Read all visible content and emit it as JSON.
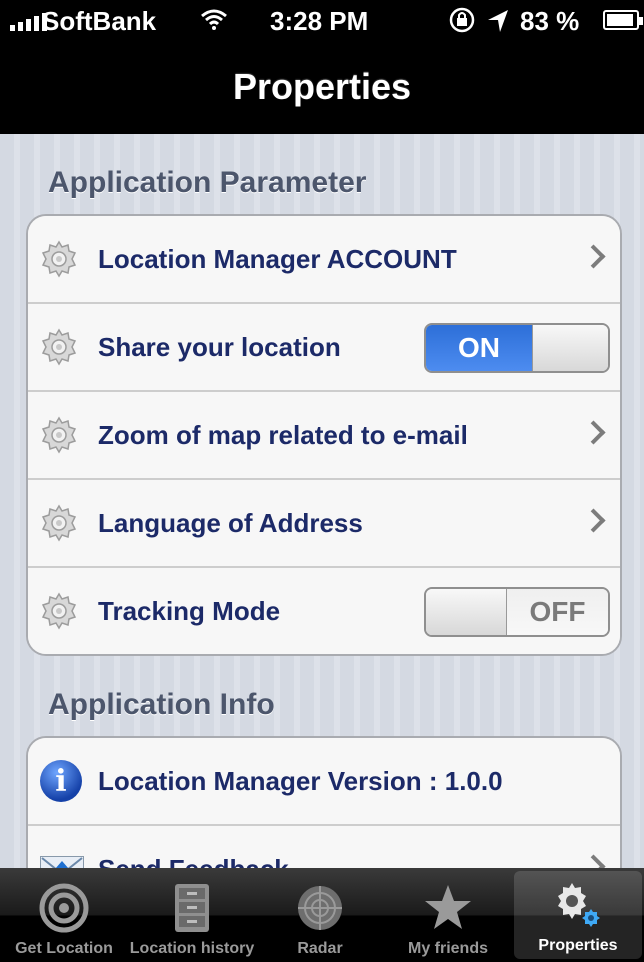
{
  "status_bar": {
    "carrier": "SoftBank",
    "time": "3:28 PM",
    "battery_percent": "83 %"
  },
  "nav": {
    "title": "Properties"
  },
  "sections": {
    "parameter": {
      "header": "Application Parameter",
      "rows": [
        {
          "label": "Location Manager ACCOUNT"
        },
        {
          "label": "Share your location",
          "toggle": "ON"
        },
        {
          "label": "Zoom of map related to e-mail"
        },
        {
          "label": "Language of Address"
        },
        {
          "label": "Tracking Mode",
          "toggle": "OFF"
        }
      ]
    },
    "info": {
      "header": "Application Info",
      "rows": [
        {
          "label": "Location Manager Version : 1.0.0"
        },
        {
          "label": "Send Feedback"
        }
      ]
    }
  },
  "tabs": [
    {
      "label": "Get Location",
      "icon": "target-icon"
    },
    {
      "label": "Location history",
      "icon": "cabinet-icon"
    },
    {
      "label": "Radar",
      "icon": "radar-icon"
    },
    {
      "label": "My friends",
      "icon": "star-icon"
    },
    {
      "label": "Properties",
      "icon": "gears-icon",
      "selected": true
    }
  ]
}
